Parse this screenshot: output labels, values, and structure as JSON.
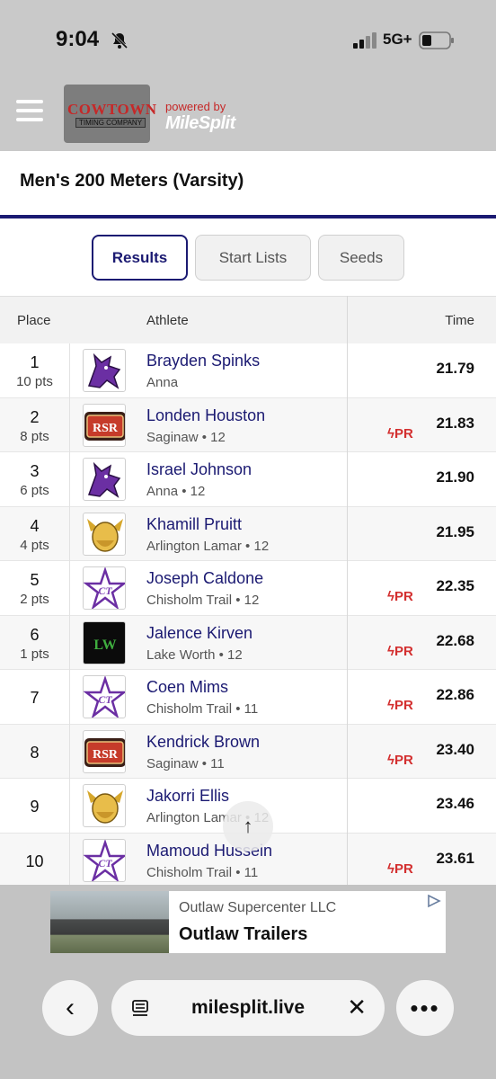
{
  "status_bar": {
    "time": "9:04",
    "network": "5G+"
  },
  "header": {
    "logo_main": "COWTOWN",
    "logo_sub": "TIMING COMPANY",
    "powered_by": "powered by",
    "brand": "MileSplit"
  },
  "page": {
    "title": "Men's 200 Meters (Varsity)"
  },
  "tabs": [
    {
      "label": "Results",
      "active": true
    },
    {
      "label": "Start Lists",
      "active": false
    },
    {
      "label": "Seeds",
      "active": false
    }
  ],
  "table": {
    "headers": {
      "place": "Place",
      "athlete": "Athlete",
      "time": "Time"
    },
    "pr_label": "PR",
    "rows": [
      {
        "place": "1",
        "pts": "10 pts",
        "name": "Brayden Spinks",
        "team": "Anna",
        "time": "21.79",
        "pr": false,
        "logo": "coyote"
      },
      {
        "place": "2",
        "pts": "8 pts",
        "name": "Londen Houston",
        "team": "Saginaw • 12",
        "time": "21.83",
        "pr": true,
        "logo": "rsr"
      },
      {
        "place": "3",
        "pts": "6 pts",
        "name": "Israel Johnson",
        "team": "Anna • 12",
        "time": "21.90",
        "pr": false,
        "logo": "coyote"
      },
      {
        "place": "4",
        "pts": "4 pts",
        "name": "Khamill Pruitt",
        "team": "Arlington Lamar • 12",
        "time": "21.95",
        "pr": false,
        "logo": "viking"
      },
      {
        "place": "5",
        "pts": "2 pts",
        "name": "Joseph Caldone",
        "team": "Chisholm Trail • 12",
        "time": "22.35",
        "pr": true,
        "logo": "star"
      },
      {
        "place": "6",
        "pts": "1 pts",
        "name": "Jalence Kirven",
        "team": "Lake Worth • 12",
        "time": "22.68",
        "pr": true,
        "logo": "lw"
      },
      {
        "place": "7",
        "pts": "",
        "name": "Coen Mims",
        "team": "Chisholm Trail • 11",
        "time": "22.86",
        "pr": true,
        "logo": "star"
      },
      {
        "place": "8",
        "pts": "",
        "name": "Kendrick Brown",
        "team": "Saginaw • 11",
        "time": "23.40",
        "pr": true,
        "logo": "rsr"
      },
      {
        "place": "9",
        "pts": "",
        "name": "Jakorri Ellis",
        "team": "Arlington Lamar • 12",
        "time": "23.46",
        "pr": false,
        "logo": "viking"
      },
      {
        "place": "10",
        "pts": "",
        "name": "Mamoud Hussein",
        "team": "Chisholm Trail • 11",
        "time": "23.61",
        "pr": true,
        "logo": "star"
      }
    ]
  },
  "ad": {
    "company": "Outlaw Supercenter LLC",
    "title": "Outlaw Trailers"
  },
  "browser": {
    "url": "milesplit.live"
  },
  "colors": {
    "navy": "#1b1a72",
    "pr_red": "#d32f2f",
    "brand_red": "#c62828"
  }
}
